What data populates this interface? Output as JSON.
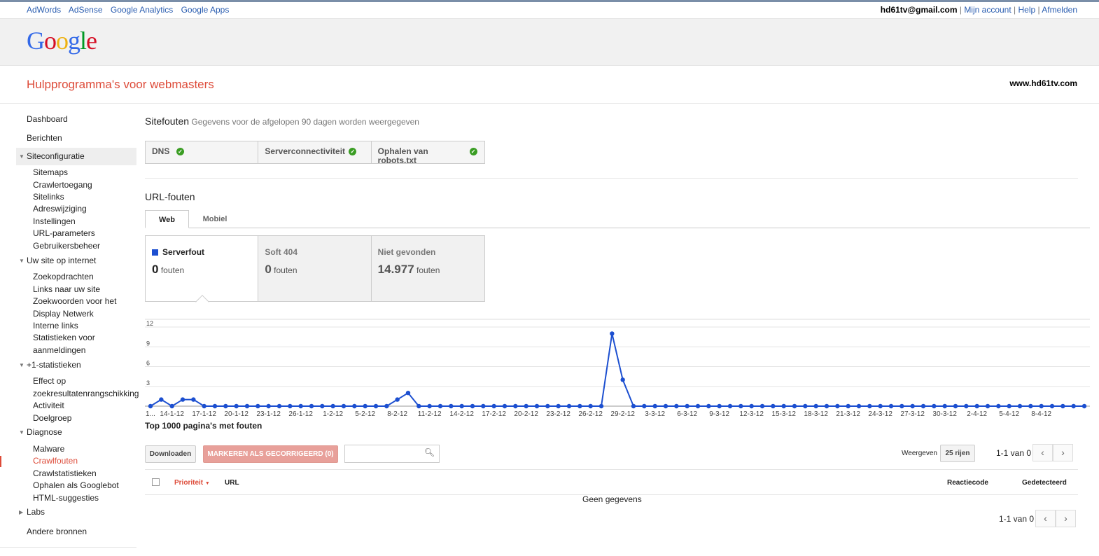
{
  "topbar": {
    "links": [
      "AdWords",
      "AdSense",
      "Google Analytics",
      "Google Apps"
    ],
    "email": "hd61tv@gmail.com",
    "account": "Mijn account",
    "help": "Help",
    "logout": "Afmelden"
  },
  "logo": {
    "text": "Google"
  },
  "header": {
    "title": "Hulpprogramma's voor webmasters",
    "site": "www.hd61tv.com"
  },
  "sidebar": {
    "dashboard": "Dashboard",
    "berichten": "Berichten",
    "siteconfig": "Siteconfiguratie",
    "siteconfig_items": [
      "Sitemaps",
      "Crawlertoegang",
      "Sitelinks",
      "Adreswijziging",
      "Instellingen",
      "URL-parameters",
      "Gebruikersbeheer"
    ],
    "internet": "Uw site op internet",
    "internet_items": [
      "Zoekopdrachten",
      "Links naar uw site",
      "Zoekwoorden voor het",
      "Display Netwerk",
      "Interne links",
      "Statistieken voor",
      "aanmeldingen"
    ],
    "plus1": "+1-statistieken",
    "plus1_items": [
      "Effect op",
      "zoekresultatenrangschikking",
      "Activiteit",
      "Doelgroep"
    ],
    "diagnose": "Diagnose",
    "diagnose_items": [
      "Malware",
      "Crawlfouten",
      "Crawlstatistieken",
      "Ophalen als Googlebot",
      "HTML-suggesties"
    ],
    "labs": "Labs",
    "andere": "Andere bronnen"
  },
  "main": {
    "site_errors_title": "Sitefouten",
    "site_errors_sub": "Gegevens voor de afgelopen 90 dagen worden weergegeven",
    "site_boxes": [
      "DNS",
      "Serverconnectiviteit",
      "Ophalen van robots.txt"
    ],
    "url_errors_title": "URL-fouten",
    "tabs": [
      "Web",
      "Mobiel"
    ],
    "error_boxes": [
      {
        "label": "Serverfout",
        "count": "0",
        "unit": "fouten"
      },
      {
        "label": "Soft 404",
        "count": "0",
        "unit": "fouten"
      },
      {
        "label": "Niet gevonden",
        "count": "14.977",
        "unit": "fouten"
      }
    ],
    "top_title": "Top 1000 pagina's met fouten",
    "download": "Downloaden",
    "mark": "MARKEREN ALS GECORRIGEERD (0)",
    "search_placeholder": "",
    "show_label": "Weergeven",
    "rows_label": "25 rijen",
    "pager": "1-1 van 0",
    "columns": {
      "priority": "Prioriteit",
      "url": "URL",
      "code": "Reactiecode",
      "detected": "Gedetecteerd"
    },
    "no_data": "Geen gegevens"
  },
  "colors": {
    "accent": "#dd4b39",
    "series": "#1c4fd0",
    "link": "#2a5db0"
  },
  "chart_data": {
    "type": "line",
    "series": [
      {
        "name": "Serverfout",
        "values": [
          0,
          1,
          0,
          1,
          1,
          0,
          0,
          0,
          0,
          0,
          0,
          0,
          0,
          0,
          0,
          0,
          0,
          0,
          0,
          0,
          0,
          0,
          0,
          1,
          2,
          0,
          0,
          0,
          0,
          0,
          0,
          0,
          0,
          0,
          0,
          0,
          0,
          0,
          0,
          0,
          0,
          0,
          0,
          11,
          4,
          0,
          0,
          0,
          0,
          0,
          0,
          0,
          0,
          0,
          0,
          0,
          0,
          0,
          0,
          0,
          0,
          0,
          0,
          0,
          0,
          0,
          0,
          0,
          0,
          0,
          0,
          0,
          0,
          0,
          0,
          0,
          0,
          0,
          0,
          0,
          0,
          0,
          0,
          0,
          0,
          0,
          0,
          0
        ]
      }
    ],
    "x_labels": [
      "1...",
      "14-1-12",
      "17-1-12",
      "20-1-12",
      "23-1-12",
      "26-1-12",
      "1-2-12",
      "5-2-12",
      "8-2-12",
      "11-2-12",
      "14-2-12",
      "17-2-12",
      "20-2-12",
      "23-2-12",
      "26-2-12",
      "29-2-12",
      "3-3-12",
      "6-3-12",
      "9-3-12",
      "12-3-12",
      "15-3-12",
      "18-3-12",
      "21-3-12",
      "24-3-12",
      "27-3-12",
      "30-3-12",
      "2-4-12",
      "5-4-12",
      "8-4-12"
    ],
    "y_ticks": [
      "12",
      "9",
      "6",
      "3"
    ],
    "ylim": [
      0,
      12
    ],
    "grid": true
  }
}
